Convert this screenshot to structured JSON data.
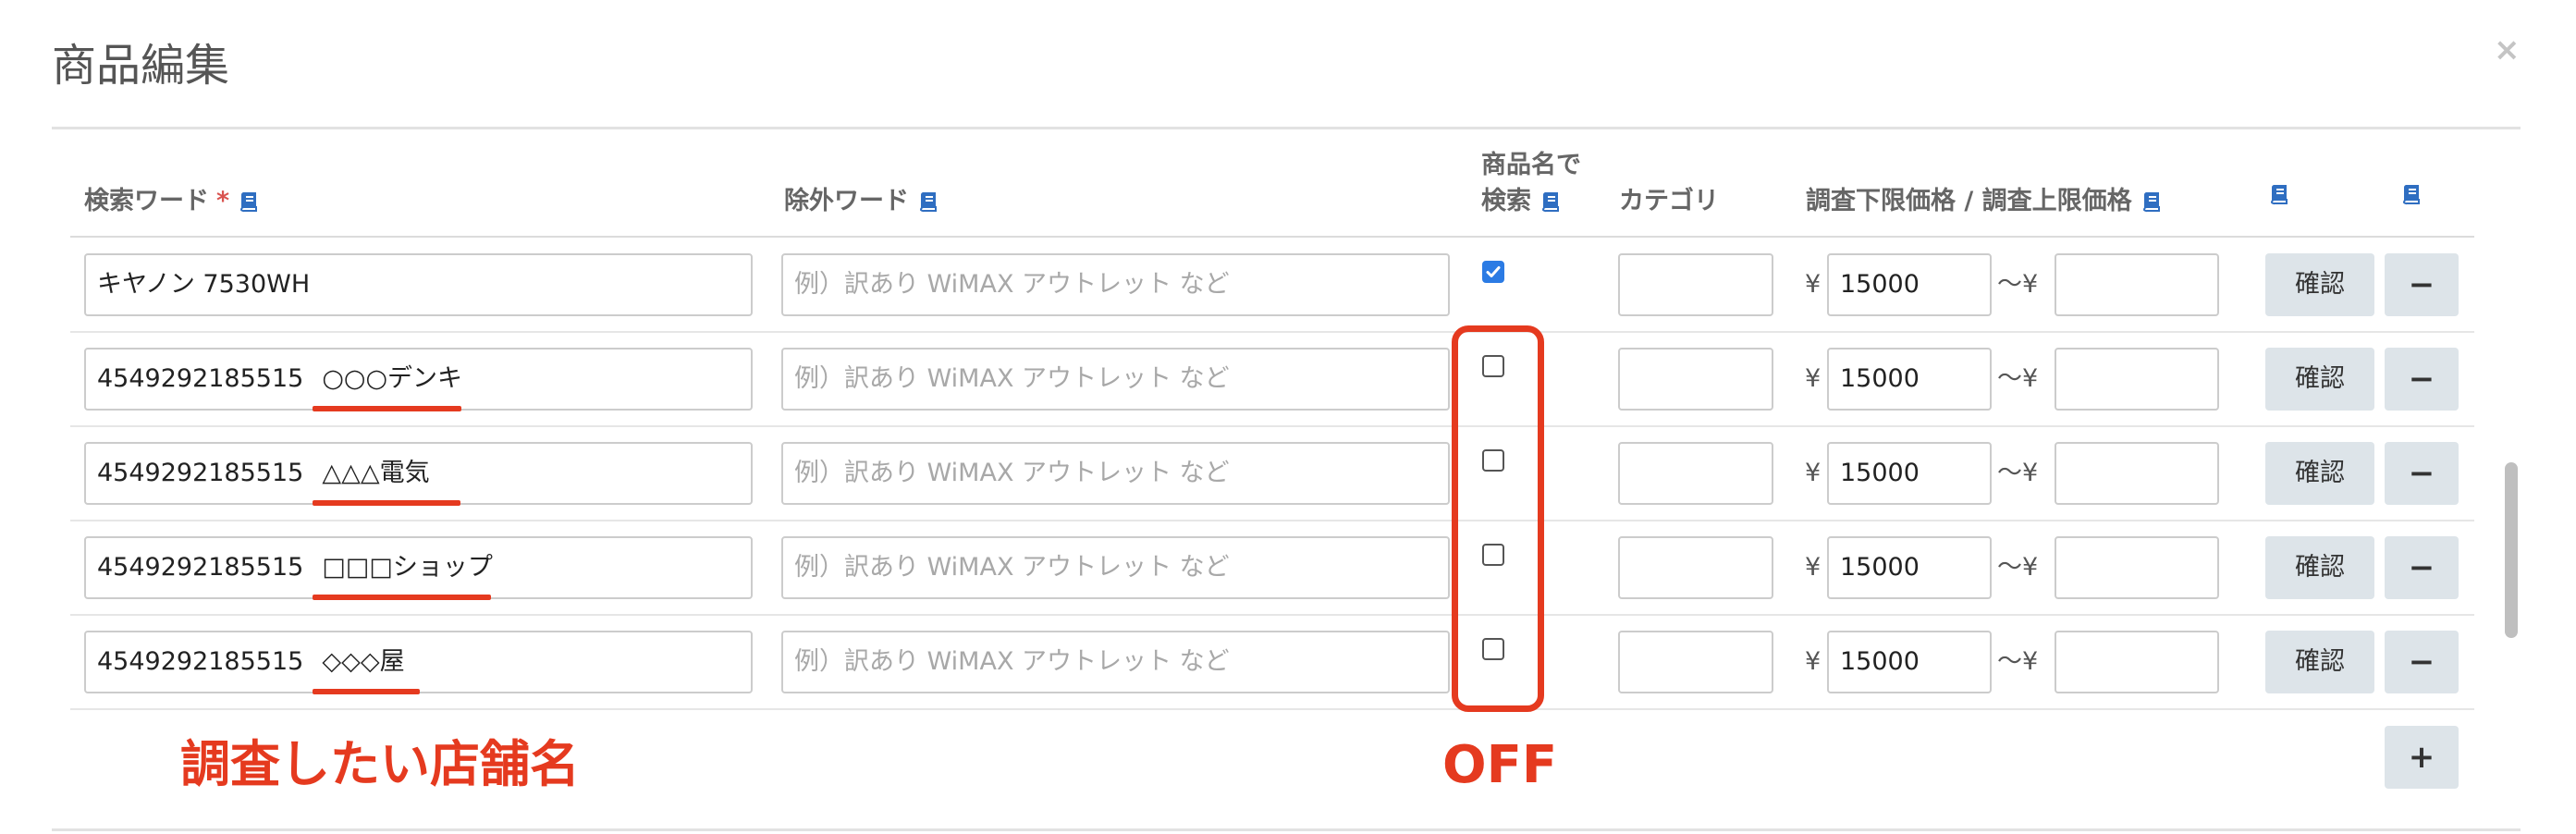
{
  "dialog": {
    "title": "商品編集",
    "close_label": "×"
  },
  "headers": {
    "search_word": "検索ワード",
    "required_mark": "*",
    "exclude_word": "除外ワード",
    "name_search_line1": "商品名で",
    "name_search_line2": "検索",
    "category": "カテゴリ",
    "price_range": "調査下限価格 / 調査上限価格"
  },
  "placeholders": {
    "exclude": "例）訳あり WiMAX アウトレット など"
  },
  "currency": "¥",
  "tilde": "〜",
  "confirm_label": "確認",
  "remove_label": "−",
  "add_label": "+",
  "rows": [
    {
      "search_code": "キヤノン 7530WH",
      "search_store": "",
      "name_search_checked": true,
      "category": "",
      "lower_price": "15000",
      "upper_price": ""
    },
    {
      "search_code": "4549292185515",
      "search_store": "○○○デンキ",
      "name_search_checked": false,
      "category": "",
      "lower_price": "15000",
      "upper_price": ""
    },
    {
      "search_code": "4549292185515",
      "search_store": "△△△電気",
      "name_search_checked": false,
      "category": "",
      "lower_price": "15000",
      "upper_price": ""
    },
    {
      "search_code": "4549292185515",
      "search_store": "□□□ショップ",
      "name_search_checked": false,
      "category": "",
      "lower_price": "15000",
      "upper_price": ""
    },
    {
      "search_code": "4549292185515",
      "search_store": "◇◇◇屋",
      "name_search_checked": false,
      "category": "",
      "lower_price": "15000",
      "upper_price": ""
    }
  ],
  "annotations": {
    "store_name": "調査したい店舗名",
    "off": "OFF"
  },
  "icons": {
    "help": "book-icon",
    "close": "close-icon",
    "check": "check-icon"
  },
  "colors": {
    "annotation": "#e53a1f",
    "checkbox_checked": "#2b7be4",
    "button_bg": "#dde4e9",
    "help_icon": "#2f6ec1"
  }
}
